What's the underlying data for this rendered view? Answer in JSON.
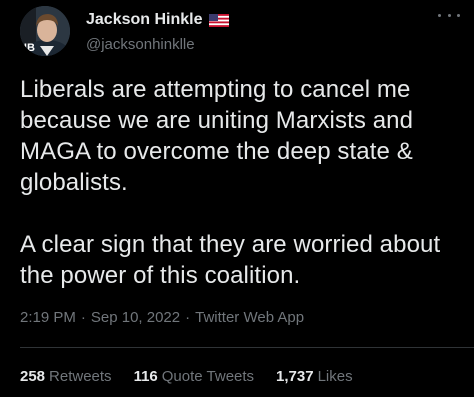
{
  "author": {
    "display_name": "Jackson Hinkle",
    "username": "@jacksonhinklle",
    "avatar_label": "HB",
    "flag_icon": "us-flag-icon"
  },
  "tweet": {
    "text": "Liberals are attempting to cancel me because we are uniting Marxists and MAGA to overcome the deep state & globalists.\n\nA clear sign that they are worried about the power of this coalition.",
    "time": "2:19 PM",
    "date": "Sep 10, 2022",
    "app": "Twitter Web App",
    "separator": "·"
  },
  "stats": {
    "retweets_count": "258",
    "retweets_label": "Retweets",
    "quotes_count": "116",
    "quotes_label": "Quote Tweets",
    "likes_count": "1,737",
    "likes_label": "Likes"
  },
  "colors": {
    "background": "#000000",
    "text": "#e7e9ea",
    "secondary": "#71767b",
    "divider": "#2f3336"
  }
}
